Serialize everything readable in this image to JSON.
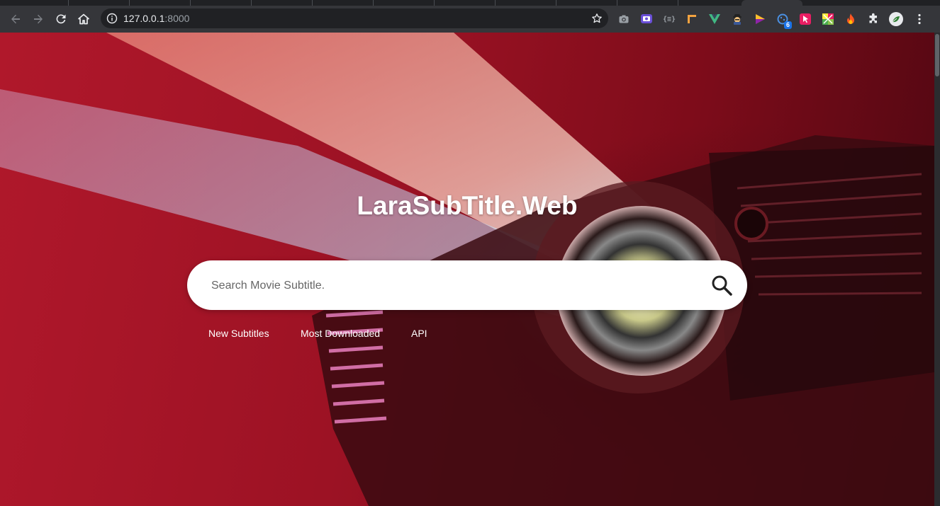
{
  "browser": {
    "url_host": "127.0.0.1",
    "url_port": ":8000",
    "extensions": [
      {
        "icon": "camera-extension-icon"
      },
      {
        "icon": "screen-recorder-extension-icon"
      },
      {
        "icon": "json-formatter-extension-icon"
      },
      {
        "icon": "ruler-extension-icon"
      },
      {
        "icon": "vue-devtools-extension-icon"
      },
      {
        "icon": "spy-extension-icon"
      },
      {
        "icon": "play-extension-icon"
      },
      {
        "icon": "cookie-extension-icon",
        "badge": "6"
      },
      {
        "icon": "pointer-extension-icon"
      },
      {
        "icon": "color-grid-extension-icon"
      },
      {
        "icon": "flame-extension-icon"
      },
      {
        "icon": "puzzle-extensions-icon"
      }
    ]
  },
  "page": {
    "title": "LaraSubTitle.Web",
    "search": {
      "placeholder": "Search Movie Subtitle."
    },
    "nav": [
      {
        "label": "New Subtitles"
      },
      {
        "label": "Most Downloaded"
      },
      {
        "label": "API"
      }
    ]
  },
  "colors": {
    "background_red": "#9c1224",
    "search_background": "#ffffff",
    "text": "#ffffff",
    "chrome_toolbar": "#35363a"
  }
}
